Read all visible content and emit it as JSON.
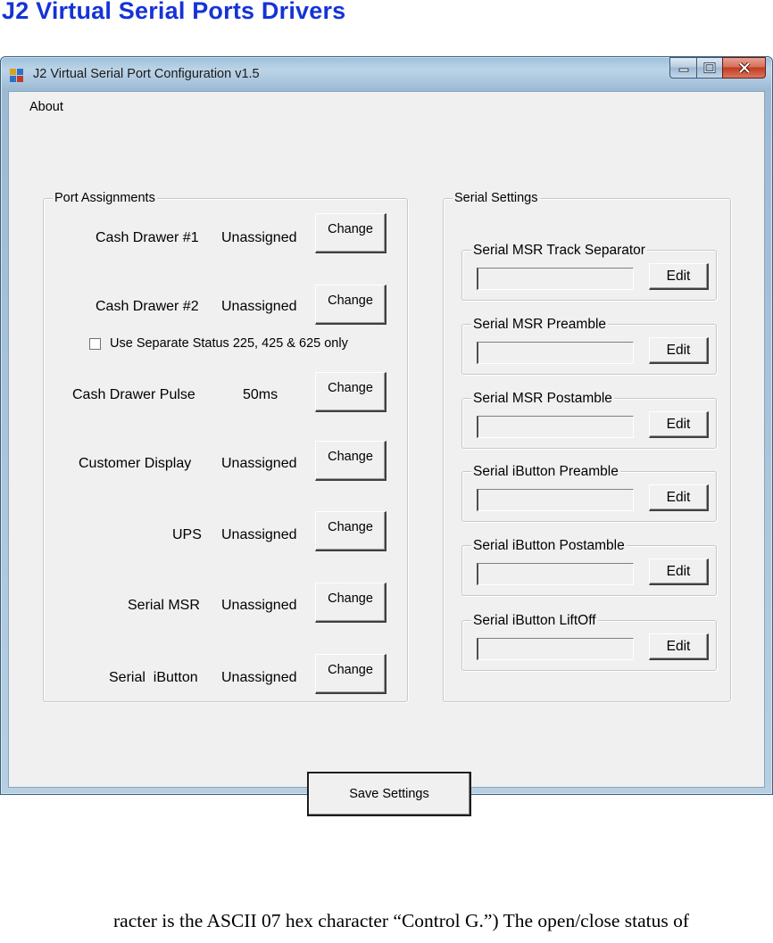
{
  "doc_heading": "J2 Virtual Serial Ports Drivers",
  "window": {
    "title": "J2 Virtual Serial Port Configuration  v1.5",
    "icon": "app-window-icon",
    "controls": {
      "minimize_icon": "minimize-icon",
      "maximize_icon": "maximize-icon",
      "close_icon": "close-icon"
    }
  },
  "menu": {
    "about": "About"
  },
  "port_assignments": {
    "title": "Port Assignments",
    "rows": [
      {
        "label": "Cash Drawer #1",
        "value": "Unassigned",
        "button": "Change"
      },
      {
        "label": "Cash Drawer #2",
        "value": "Unassigned",
        "button": "Change"
      },
      {
        "label": "Cash Drawer Pulse",
        "value": "50ms",
        "button": "Change"
      },
      {
        "label": "Customer Display",
        "value": "Unassigned",
        "button": "Change"
      },
      {
        "label": "UPS",
        "value": "Unassigned",
        "button": "Change"
      },
      {
        "label": "Serial MSR",
        "value": "Unassigned",
        "button": "Change"
      },
      {
        "label": "Serial  iButton",
        "value": "Unassigned",
        "button": "Change"
      }
    ],
    "separate_status": {
      "label": "Use Separate Status 225, 425 & 625 only",
      "checked": false
    }
  },
  "serial_settings": {
    "title": "Serial Settings",
    "groups": [
      {
        "title": "Serial MSR Track Separator",
        "value": "",
        "button": "Edit"
      },
      {
        "title": "Serial MSR Preamble",
        "value": "",
        "button": "Edit"
      },
      {
        "title": "Serial MSR Postamble",
        "value": "",
        "button": "Edit"
      },
      {
        "title": "Serial iButton Preamble",
        "value": "",
        "button": "Edit"
      },
      {
        "title": "Serial iButton Postamble",
        "value": "",
        "button": "Edit"
      },
      {
        "title": "Serial iButton LiftOff",
        "value": "",
        "button": "Edit"
      }
    ]
  },
  "save_button": "Save Settings",
  "caption": "racter is the ASCII 07 hex character “Control G.”)  The open/close status of"
}
